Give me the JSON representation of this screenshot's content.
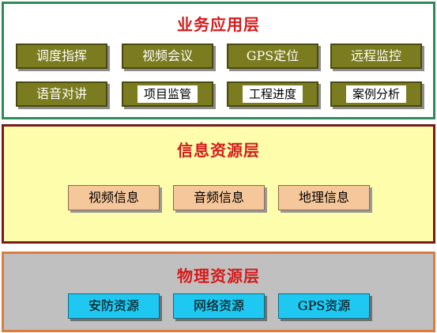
{
  "application_layer": {
    "title": "业务应用层",
    "items": [
      "调度指挥",
      "视频会议",
      "GPS定位",
      "远程监控",
      "语音对讲",
      "项目监管",
      "工程进度",
      "案例分析"
    ]
  },
  "information_layer": {
    "title": "信息资源层",
    "items": [
      "视频信息",
      "音频信息",
      "地理信息"
    ]
  },
  "physical_layer": {
    "title": "物理资源层",
    "items": [
      "安防资源",
      "网络资源",
      "GPS资源"
    ]
  },
  "colors": {
    "app_border": "#2e8b57",
    "app_button": "#7b7b1f",
    "info_background": "#fdfdab",
    "info_border": "#7a1a1a",
    "info_button": "#f6c79a",
    "phys_background": "#c0c0c0",
    "phys_border": "#e07b3a",
    "phys_button": "#1ec8f0",
    "title_red": "#d41b1b"
  }
}
